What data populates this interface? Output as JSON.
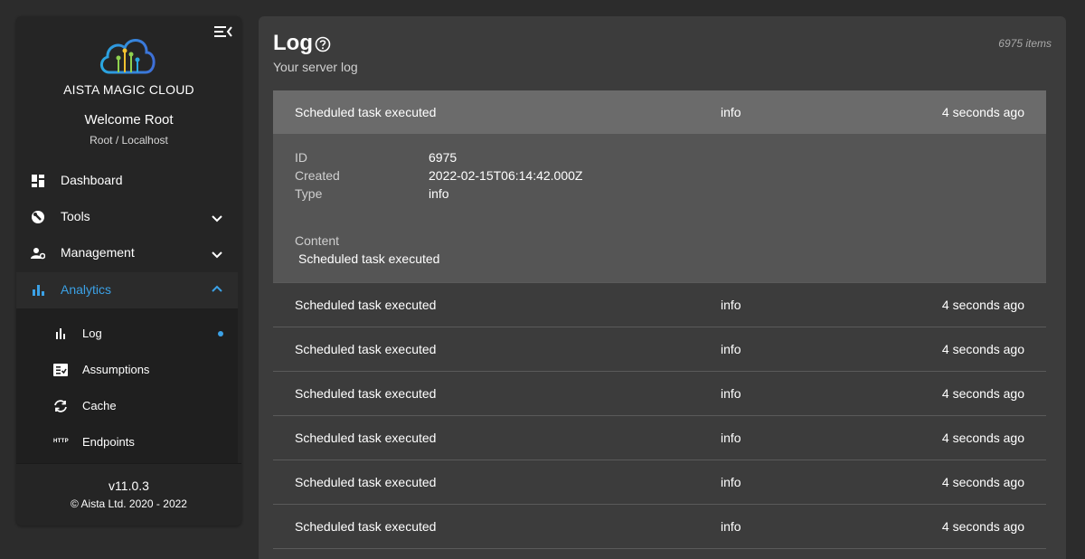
{
  "app": {
    "brand": "AISTA MAGIC CLOUD",
    "welcome": "Welcome Root",
    "user_context": "Root / Localhost"
  },
  "nav": {
    "items": [
      {
        "label": "Dashboard",
        "icon": "dashboard-icon"
      },
      {
        "label": "Tools",
        "icon": "tools-icon"
      },
      {
        "label": "Management",
        "icon": "management-icon"
      },
      {
        "label": "Analytics",
        "icon": "analytics-icon",
        "active": true
      }
    ],
    "sub_items": [
      {
        "label": "Log",
        "icon": "log-icon",
        "current": true
      },
      {
        "label": "Assumptions",
        "icon": "assumptions-icon"
      },
      {
        "label": "Cache",
        "icon": "cache-icon"
      },
      {
        "label": "Endpoints",
        "icon": "http-icon",
        "icon_text": "HTTP"
      }
    ]
  },
  "footer": {
    "version": "v11.0.3",
    "copyright": "© Aista Ltd. 2020 - 2022"
  },
  "page": {
    "title": "Log",
    "subtitle": "Your server log",
    "count": "6975 items"
  },
  "log": {
    "expanded": {
      "message": "Scheduled task executed",
      "type": "info",
      "time": "4 seconds ago",
      "details": {
        "id_label": "ID",
        "id": "6975",
        "created_label": "Created",
        "created": "2022-02-15T06:14:42.000Z",
        "type_label": "Type",
        "type": "info",
        "content_label": "Content",
        "content": "Scheduled task executed"
      }
    },
    "rows": [
      {
        "message": "Scheduled task executed",
        "type": "info",
        "time": "4 seconds ago"
      },
      {
        "message": "Scheduled task executed",
        "type": "info",
        "time": "4 seconds ago"
      },
      {
        "message": "Scheduled task executed",
        "type": "info",
        "time": "4 seconds ago"
      },
      {
        "message": "Scheduled task executed",
        "type": "info",
        "time": "4 seconds ago"
      },
      {
        "message": "Scheduled task executed",
        "type": "info",
        "time": "4 seconds ago"
      },
      {
        "message": "Scheduled task executed",
        "type": "info",
        "time": "4 seconds ago"
      }
    ]
  },
  "colors": {
    "accent": "#3ba1e6",
    "sidebar_bg": "#252525",
    "panel_bg": "#3c3c3c",
    "expanded_row_bg": "#6b6b6b"
  }
}
